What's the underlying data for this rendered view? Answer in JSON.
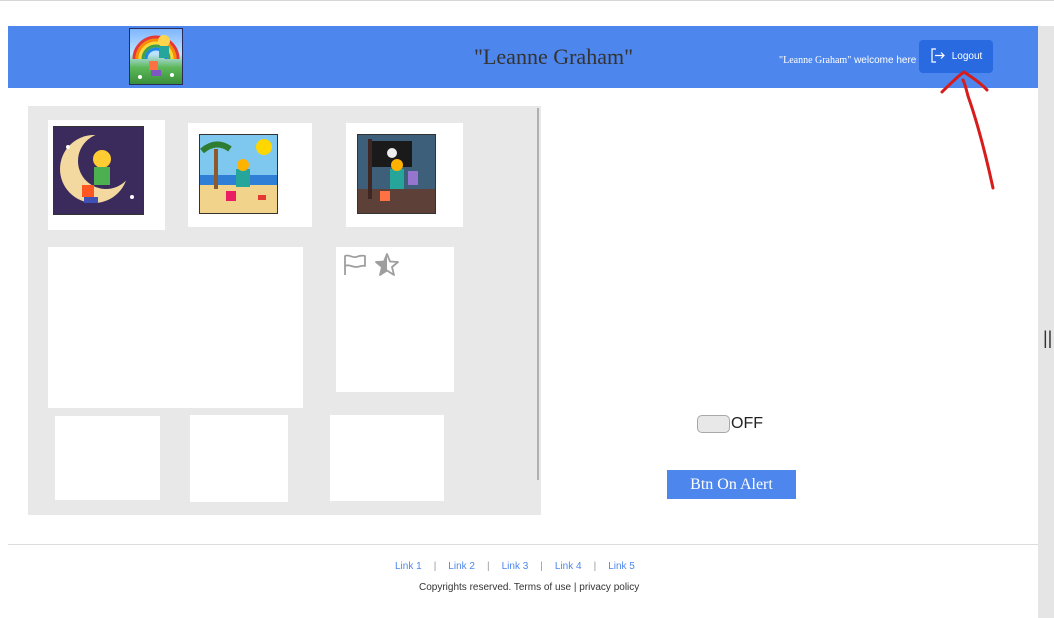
{
  "header": {
    "title": "\"Leanne Graham\"",
    "welcome_user": "\"Leanne Graham\"",
    "welcome_text": "welcome here",
    "logout_label": "Logout",
    "logout_icon": "logout-icon",
    "background_color": "#4d86ec"
  },
  "gallery": {
    "thumbnails": [
      {
        "icon": "moon-rainbow-character-art"
      },
      {
        "icon": "beach-rainbow-character-art"
      },
      {
        "icon": "pirate-rainbow-character-art"
      }
    ],
    "card_icons": [
      "flag-icon",
      "star-icon"
    ]
  },
  "controls": {
    "toggle_label": "OFF",
    "alert_button_label": "Btn On Alert",
    "accent_color": "#4d86ec"
  },
  "footer": {
    "links": [
      "Link 1",
      "Link 2",
      "Link 3",
      "Link 4",
      "Link 5"
    ],
    "copyright": "Copyrights reserved. Terms of use | privacy policy"
  }
}
